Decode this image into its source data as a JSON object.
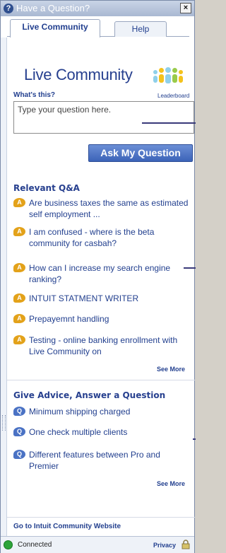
{
  "window": {
    "title": "Have a Question?",
    "close_glyph": "×",
    "help_glyph": "?"
  },
  "tabs": [
    {
      "label": "Live Community",
      "selected": true
    },
    {
      "label": "Help",
      "selected": false
    }
  ],
  "header": {
    "logo_text": "Live Community",
    "whats_this": "What's this?",
    "leaderboard": "Leaderboard"
  },
  "question": {
    "placeholder": "Type your question here.",
    "button_label": "Ask My Question"
  },
  "relevant_qa": {
    "title": "Relevant Q&A",
    "icon_glyph": "A",
    "items": [
      "Are business taxes the same as estimated self employment ...",
      "I am confused - where is the beta community for casbah?",
      "How can I increase my search engine ranking?",
      "INTUIT STATMENT WRITER",
      "Prepayemnt handling",
      "Testing - online banking enrollment with Live Community on"
    ],
    "see_more": "See More"
  },
  "give_advice": {
    "title": "Give Advice, Answer a Question",
    "icon_glyph": "Q",
    "items": [
      "Minimum shipping charged",
      "One check multiple clients",
      "Different features between Pro and Premier"
    ],
    "see_more": "See More"
  },
  "footer": {
    "community_link": "Go to Intuit Community Website",
    "status": "Connected",
    "privacy": "Privacy"
  },
  "colors": {
    "accent": "#23408f",
    "answer_icon": "#e3a21a",
    "question_icon": "#4a72c4",
    "button": "#3c63b8",
    "status_ok": "#2ea43a"
  }
}
